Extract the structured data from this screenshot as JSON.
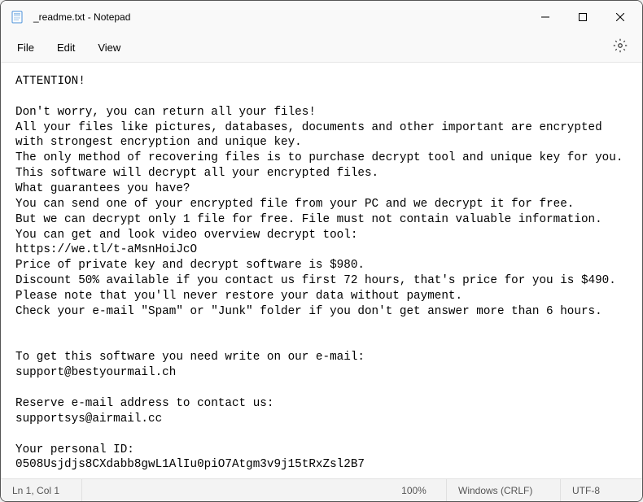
{
  "titlebar": {
    "title": "_readme.txt - Notepad"
  },
  "menubar": {
    "file": "File",
    "edit": "Edit",
    "view": "View"
  },
  "content": {
    "text": "ATTENTION!\n\nDon't worry, you can return all your files!\nAll your files like pictures, databases, documents and other important are encrypted with strongest encryption and unique key.\nThe only method of recovering files is to purchase decrypt tool and unique key for you.\nThis software will decrypt all your encrypted files.\nWhat guarantees you have?\nYou can send one of your encrypted file from your PC and we decrypt it for free.\nBut we can decrypt only 1 file for free. File must not contain valuable information.\nYou can get and look video overview decrypt tool:\nhttps://we.tl/t-aMsnHoiJcO\nPrice of private key and decrypt software is $980.\nDiscount 50% available if you contact us first 72 hours, that's price for you is $490.\nPlease note that you'll never restore your data without payment.\nCheck your e-mail \"Spam\" or \"Junk\" folder if you don't get answer more than 6 hours.\n\n\nTo get this software you need write on our e-mail:\nsupport@bestyourmail.ch\n\nReserve e-mail address to contact us:\nsupportsys@airmail.cc\n\nYour personal ID:\n0508Usjdjs8CXdabb8gwL1AlIu0piO7Atgm3v9j15tRxZsl2B7"
  },
  "statusbar": {
    "position": "Ln 1, Col 1",
    "zoom": "100%",
    "eol": "Windows (CRLF)",
    "encoding": "UTF-8"
  }
}
